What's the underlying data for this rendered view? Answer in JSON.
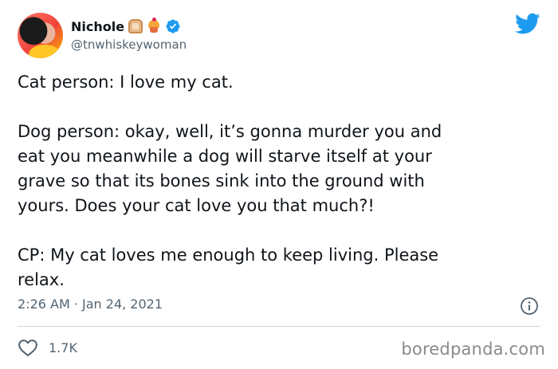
{
  "tweet": {
    "author": {
      "display_name": "Nichole",
      "name_emojis": [
        "bread-emoji",
        "cupcake-emoji"
      ],
      "handle": "@tnwhiskeywoman",
      "verified": true
    },
    "lines_block1": [
      "Cat person: I love my cat."
    ],
    "lines_block2": [
      "Dog person: okay, well, it’s gonna murder you and",
      "eat you meanwhile a dog will starve itself at your",
      "grave so that its bones sink into the ground with",
      "yours. Does your cat love you that much?!"
    ],
    "lines_block3": [
      "CP: My cat loves me enough to keep living. Please",
      "relax."
    ],
    "timestamp": "2:26 AM · Jan 24, 2021",
    "like_count": "1.7K"
  },
  "watermark": "boredpanda.com",
  "colors": {
    "twitter_blue": "#1d9bf0",
    "text": "#0f1419",
    "secondary_text": "#536471"
  }
}
